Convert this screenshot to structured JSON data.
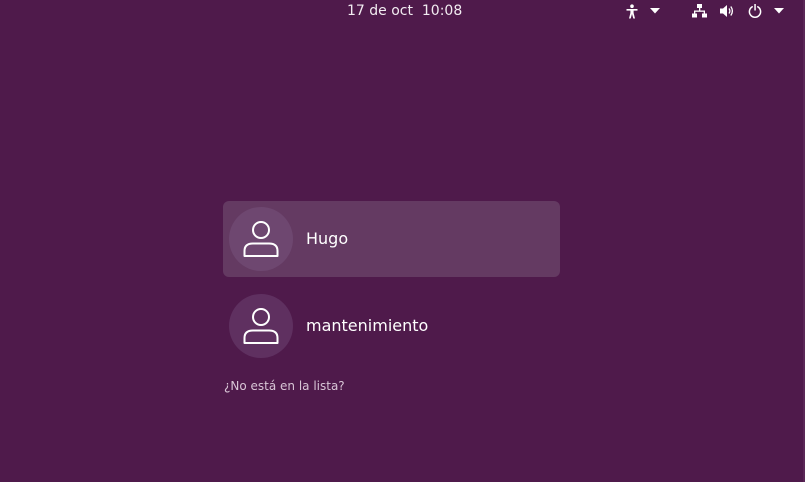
{
  "topbar": {
    "date": "17 de oct",
    "time": "10:08",
    "icons": [
      "accessibility-icon",
      "dropdown-arrow-icon",
      "network-wired-icon",
      "volume-icon",
      "power-icon",
      "dropdown-arrow-icon"
    ]
  },
  "login": {
    "users": [
      {
        "name": "Hugo",
        "selected": true
      },
      {
        "name": "mantenimiento",
        "selected": false
      }
    ],
    "not_listed": "¿No está en la lista?"
  },
  "colors": {
    "background": "#4f1a4b",
    "selected_row": "#643a62",
    "avatar": "#5f3060"
  }
}
